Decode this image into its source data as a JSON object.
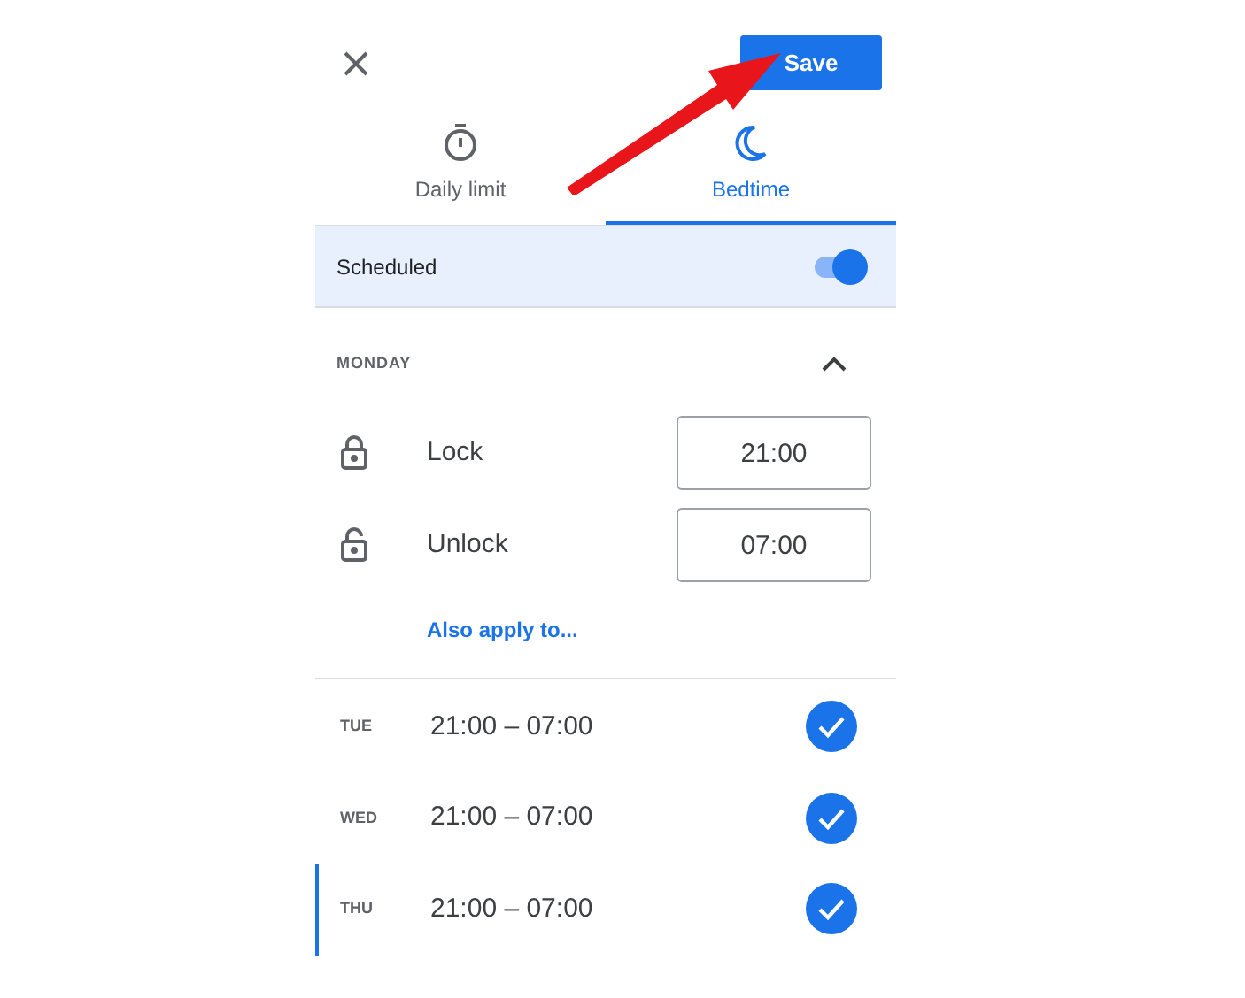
{
  "save_button": "Save",
  "tabs": [
    {
      "label": "Daily limit",
      "kind": "timer",
      "selected": false
    },
    {
      "label": "Bedtime",
      "kind": "moon",
      "selected": true
    }
  ],
  "scheduled": {
    "label": "Scheduled",
    "on": true
  },
  "day_section": {
    "title": "MONDAY",
    "expanded": true,
    "times": [
      {
        "kind": "lock",
        "label": "Lock",
        "value": "21:00"
      },
      {
        "kind": "unlock",
        "label": "Unlock",
        "value": "07:00"
      }
    ],
    "link": "Also apply to..."
  },
  "days": [
    {
      "day": "TUE",
      "range": "21:00 – 07:00",
      "checked": true,
      "selected": false
    },
    {
      "day": "WED",
      "range": "21:00 – 07:00",
      "checked": true,
      "selected": false
    },
    {
      "day": "THU",
      "range": "21:00 – 07:00",
      "checked": true,
      "selected": true
    }
  ]
}
